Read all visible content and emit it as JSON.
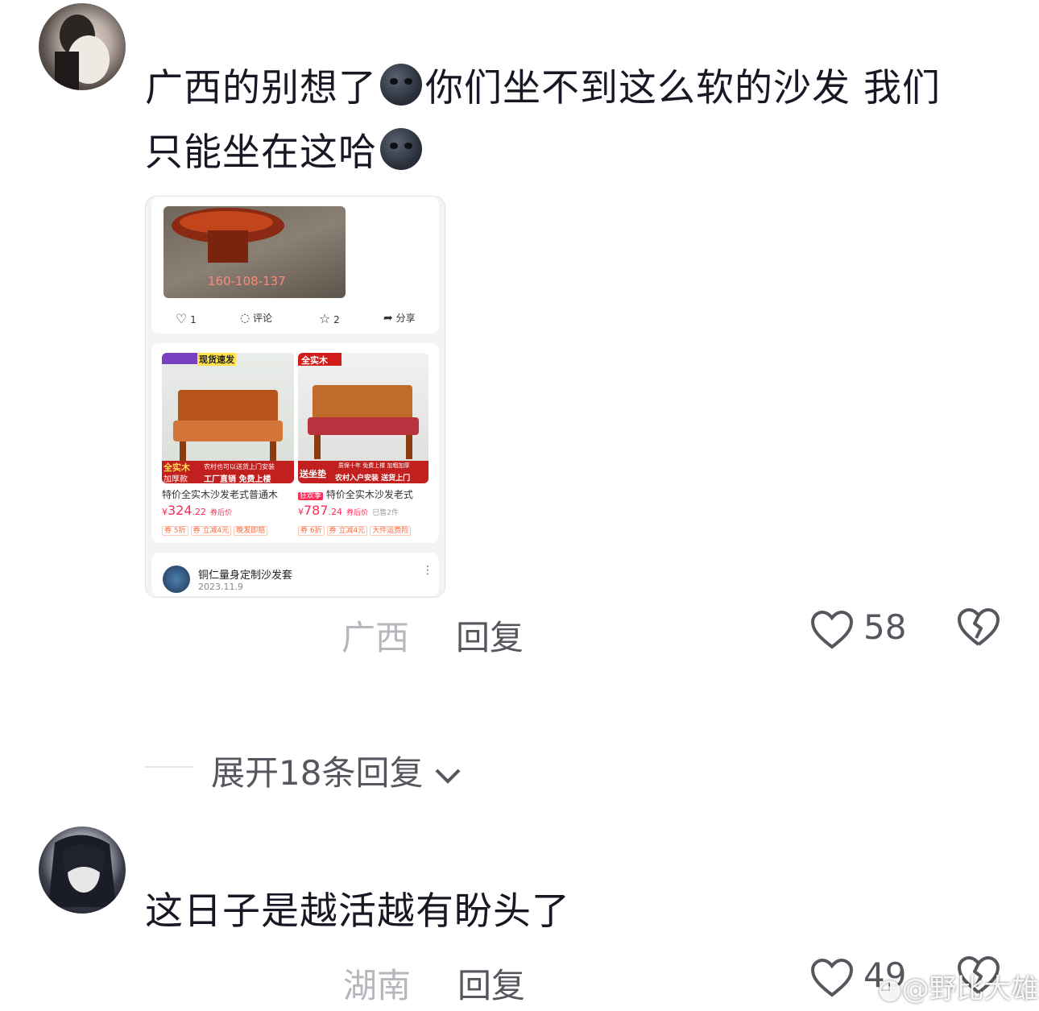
{
  "comments": [
    {
      "text_part1": "广西的别想了",
      "text_part2": "你们坐不到这么软的沙发 我们",
      "text_part3": "只能坐在这哈",
      "emoji": "new-moon-face-emoji",
      "location": "广西",
      "reply_label": "回复",
      "like_count": "58"
    },
    {
      "text": "这日子是越活越有盼头了",
      "location": "湖南",
      "reply_label": "回复",
      "like_count": "49"
    }
  ],
  "expand_replies": "展开18条回复",
  "embedded_screenshot": {
    "post_image_caption": "160-108-137",
    "actions": {
      "like_count": "1",
      "comment_label": "评论",
      "favorite_count": "2",
      "share_label": "分享"
    },
    "products": [
      {
        "banner_top": "现货速发",
        "banner_bottom_left": "全实木",
        "banner_bottom_left2": "加厚款",
        "banner_bottom_right": "农村也可以送货上门安装",
        "banner_bottom_right2": "工厂直销 免费上楼",
        "title": "特价全实木沙发老式普通木",
        "price_symbol": "¥",
        "price_int": "324",
        "price_dec": ".22",
        "price_note": "券后价",
        "sold": "",
        "tags": [
          "券 5折",
          "券 立减4元",
          "晚发即赔"
        ]
      },
      {
        "banner_top": "全实木",
        "banner_bottom_left": "送坐垫",
        "banner_bottom_right": "质保十年 免费上楼 加粗加厚",
        "banner_bottom_right2": "农村入户安装 送货上门",
        "badge": "狂欢季",
        "title": "特价全实木沙发老式",
        "price_symbol": "¥",
        "price_int": "787",
        "price_dec": ".24",
        "price_note": "券后价",
        "sold": "已售2件",
        "tags": [
          "券 6折",
          "券 立减4元",
          "大件运费险"
        ]
      }
    ],
    "author": {
      "name": "铜仁量身定制沙发套",
      "date": "2023.11.9"
    }
  },
  "watermark": "@野比大雄",
  "colors": {
    "accent_red": "#fe2c55",
    "text_primary": "#161823",
    "text_secondary": "#55575e",
    "text_meta": "#b5b7bd"
  }
}
